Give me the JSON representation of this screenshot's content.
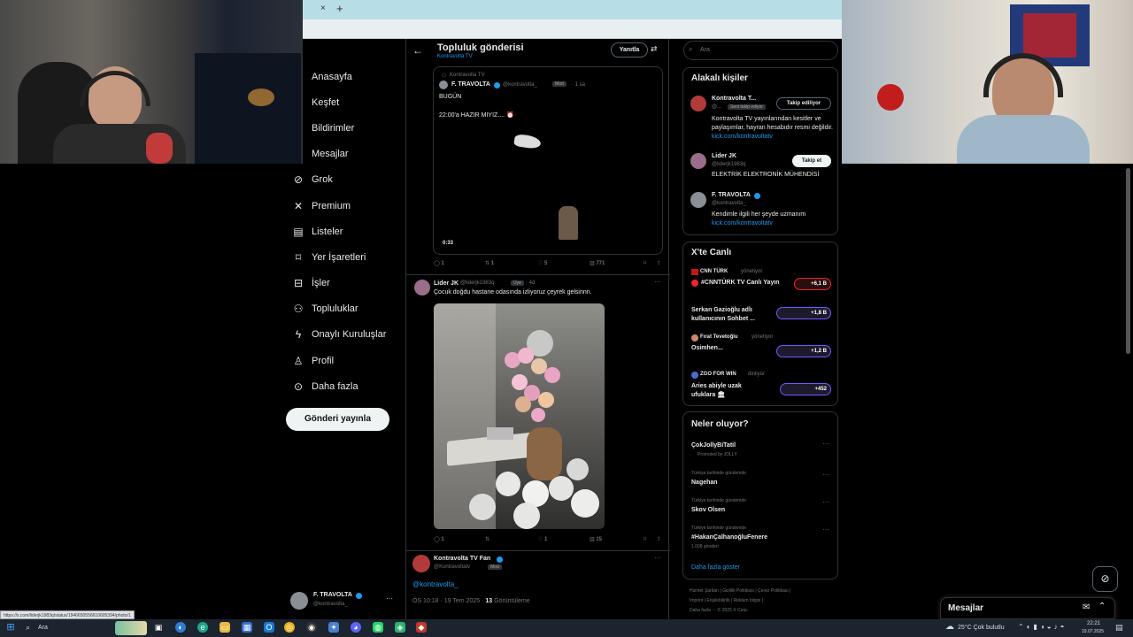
{
  "browser": {
    "tab_close": "×",
    "tab_new": "+",
    "status_url": "https://x.com/liderjk1983q/status/1946650556610605394/photo/1"
  },
  "nav": {
    "items": [
      {
        "label": "Anasayfa",
        "icon": ""
      },
      {
        "label": "Keşfet",
        "icon": ""
      },
      {
        "label": "Bildirimler",
        "icon": ""
      },
      {
        "label": "Mesajlar",
        "icon": ""
      },
      {
        "label": "Grok",
        "icon": "grok-icon"
      },
      {
        "label": "Premium",
        "icon": "x-icon"
      },
      {
        "label": "Listeler",
        "icon": "list-icon"
      },
      {
        "label": "Yer İşaretleri",
        "icon": "bookmark-icon"
      },
      {
        "label": "İşler",
        "icon": "briefcase-icon"
      },
      {
        "label": "Topluluklar",
        "icon": "people-icon"
      },
      {
        "label": "Onaylı Kuruluşlar",
        "icon": "lightning-icon"
      },
      {
        "label": "Profil",
        "icon": "person-icon"
      },
      {
        "label": "Daha fazla",
        "icon": "more-circle-icon"
      }
    ],
    "post_button": "Gönderi yayınla",
    "profile": {
      "name": "F. TRAVOLTA",
      "handle": "@kontravolta_",
      "more": "···"
    }
  },
  "header": {
    "title": "Topluluk gönderisi",
    "subtitle": "Kontravolta TV",
    "reply_button": "Yanıtla"
  },
  "quoted_post": {
    "community": "Kontravolta TV",
    "name": "F. TRAVOLTA",
    "handle": "@kontravolta_",
    "badge": "Mod",
    "time": "· 1 sa",
    "line1": "BUGÜN",
    "line2": "22:00'a HAZIR MIYIZ.... ⏰",
    "video_time": "0:33",
    "stats": {
      "replies": "1",
      "reposts": "1",
      "likes": "5",
      "views": "771"
    }
  },
  "reply_post": {
    "name": "Lider JK",
    "handle": "@liderjk1983q",
    "badge": "Üye",
    "time": "· 4d",
    "text": "Çocuk doğdu hastane odasında izliyoruz çeyrek gelsinnn.",
    "stats": {
      "replies": "1",
      "reposts": "",
      "likes": "1",
      "views": "15"
    }
  },
  "fan_post": {
    "name": "Kontravolta TV Fan",
    "handle": "@Kontravoltatv",
    "badge": "Mod",
    "mention": "@kontravolta_",
    "meta_time": "ÖS 10:18 · 19 Tem 2025 · ",
    "meta_views_count": "13",
    "meta_views_label": " Görüntüleme"
  },
  "search": {
    "placeholder": "Ara"
  },
  "related": {
    "title": "Alakalı kişiler",
    "people": [
      {
        "name": "Kontravolta T...",
        "handle": "@...",
        "tag": "Seni takip ediyor",
        "button": "Takip ediliyor",
        "bio": "Kontravolta TV yayınlarından kesitler ve paylaşımlar, hayran hesabıdır resmi değildir. ",
        "link": "kick.com/kontravoltatv"
      },
      {
        "name": "Lider JK",
        "handle": "@liderjk1983q",
        "button": "Takip et",
        "bio": "ELEKTRİK ELEKTRONİK MÜHENDİSİ"
      },
      {
        "name": "F. TRAVOLTA",
        "handle": "@kontravolta_",
        "bio": "Kendimle ilgili her şeyde uzmanım",
        "link": "kick.com/kontravoltatv"
      }
    ]
  },
  "live": {
    "title": "X'te Canlı",
    "items": [
      {
        "host": "CNN TÜRK",
        "status": "yönetiyor",
        "title": "#CNNTÜRK TV Canlı Yayın",
        "count": "+6,1 B"
      },
      {
        "host": "",
        "status": "",
        "title": "Serkan Gazioğlu adlı kullanıcının Sohbet ...",
        "count": "+1,8 B"
      },
      {
        "host": "Fırat Tevetoğlu",
        "status": "yönetiyor",
        "title": "Osimhen...",
        "count": "+1,2 B"
      },
      {
        "host": "ZGO FOR WIN",
        "status": "dinliyor",
        "title": "Aries abiyle uzak ufuklara 🏛",
        "count": "+452"
      }
    ]
  },
  "trends": {
    "title": "Neler oluyor?",
    "items": [
      {
        "context": "",
        "name": "ÇokJollyBiTatil",
        "sub": "Promoted by JOLLY"
      },
      {
        "context": "Türkiye tarihinde gündemde",
        "name": "Nagehan",
        "sub": ""
      },
      {
        "context": "Türkiye tarihinde gündemde",
        "name": "Skov Olsen",
        "sub": ""
      },
      {
        "context": "Türkiye tarihinde gündemde",
        "name": "#HakanÇalhanoğluFenere",
        "sub": "1.008 gönderi"
      }
    ],
    "show_more": "Daha fazla göster"
  },
  "footer": {
    "line1": "Hizmet Şartları  |  Gizlilik Politikası  |  Çerez Politikası  |",
    "line2": "Imprint  |  Erişilebilirlik  |  Reklam bilgisi  |",
    "line3": "Daha fazla ···  © 2025 X Corp."
  },
  "dm": {
    "title": "Mesajlar"
  },
  "taskbar": {
    "search": "Ara",
    "weather": "25°C  Çok bulutlu",
    "time": "22:21",
    "date": "19.07.2025"
  },
  "colors": {
    "accent": "#1d9bf0",
    "bg": "#000000",
    "border": "#2f3336",
    "muted": "#71767b"
  }
}
